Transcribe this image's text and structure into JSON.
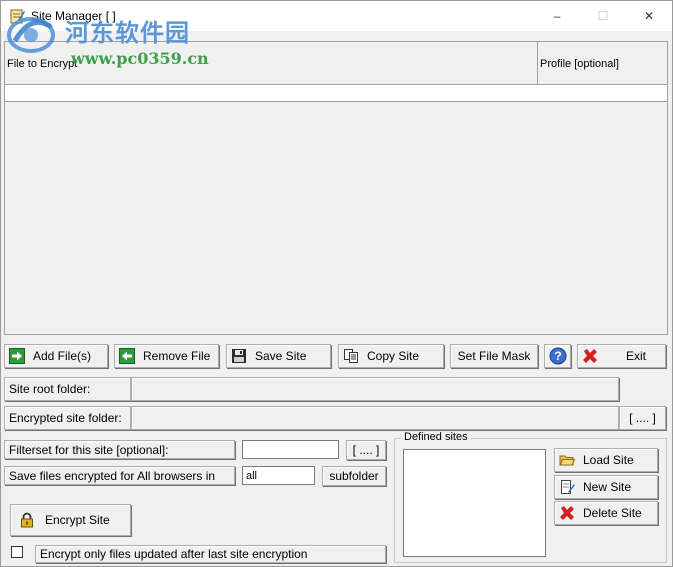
{
  "window": {
    "title": "Site Manager [ ]",
    "controls": {
      "minimize": "–",
      "maximize": "☐",
      "close": "✕"
    }
  },
  "watermark": {
    "cn_text": "河东软件园",
    "url": "www.pc0359.cn"
  },
  "file_list": {
    "columns": [
      "File to Encrypt",
      "Profile [optional]"
    ]
  },
  "toolbar": {
    "add_files": "Add File(s)",
    "remove_file": "Remove File",
    "save_site": "Save Site",
    "copy_site": "Copy Site",
    "set_file_mask": "Set File Mask",
    "help": "?",
    "exit": "Exit"
  },
  "fields": {
    "site_root_folder_label": "Site root folder:",
    "site_root_folder_value": "",
    "encrypted_site_folder_label": "Encrypted site folder:",
    "encrypted_site_folder_value": "",
    "browse_label": "[ .... ]",
    "filterset_label": "Filterset for this site [optional]:",
    "filterset_value": "",
    "filterset_browse": "[ .... ]",
    "save_files_label": "Save files encrypted for All browsers in",
    "save_files_value": "all",
    "subfolder_label": "subfolder"
  },
  "actions": {
    "encrypt_site": "Encrypt Site",
    "encrypt_only_updated": "Encrypt only files updated after last site encryption"
  },
  "defined_sites": {
    "title": "Defined sites",
    "items": [],
    "load_site": "Load Site",
    "new_site": "New Site",
    "delete_site": "Delete Site"
  },
  "colors": {
    "window_bg": "#f0f0f0",
    "watermark_blue": "#4f8fd6",
    "watermark_green": "#2e9a3c",
    "add_green": "#2e9a3c",
    "delete_red": "#d21f1f"
  }
}
